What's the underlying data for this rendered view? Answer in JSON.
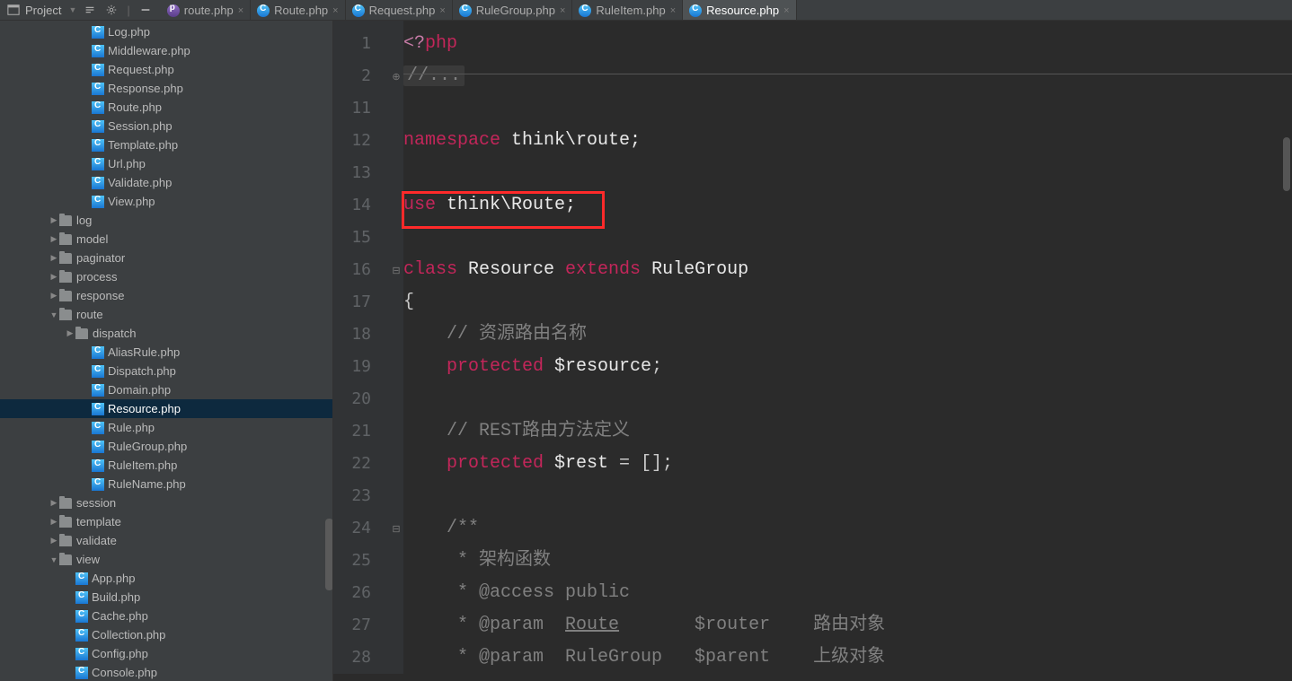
{
  "header": {
    "project_label": "Project"
  },
  "tabs": [
    {
      "label": "route.php",
      "icon": "p",
      "active": false
    },
    {
      "label": "Route.php",
      "icon": "c",
      "active": false
    },
    {
      "label": "Request.php",
      "icon": "c",
      "active": false
    },
    {
      "label": "RuleGroup.php",
      "icon": "c",
      "active": false
    },
    {
      "label": "RuleItem.php",
      "icon": "c",
      "active": false
    },
    {
      "label": "Resource.php",
      "icon": "c",
      "active": true
    }
  ],
  "tree": [
    {
      "indent": 5,
      "type": "file",
      "icon": "c",
      "label": "Log.php"
    },
    {
      "indent": 5,
      "type": "file",
      "icon": "c",
      "label": "Middleware.php"
    },
    {
      "indent": 5,
      "type": "file",
      "icon": "c",
      "label": "Request.php"
    },
    {
      "indent": 5,
      "type": "file",
      "icon": "c",
      "label": "Response.php"
    },
    {
      "indent": 5,
      "type": "file",
      "icon": "c",
      "label": "Route.php"
    },
    {
      "indent": 5,
      "type": "file",
      "icon": "c",
      "label": "Session.php"
    },
    {
      "indent": 5,
      "type": "file",
      "icon": "c",
      "label": "Template.php"
    },
    {
      "indent": 5,
      "type": "file",
      "icon": "c",
      "label": "Url.php"
    },
    {
      "indent": 5,
      "type": "file",
      "icon": "c",
      "label": "Validate.php"
    },
    {
      "indent": 5,
      "type": "file",
      "icon": "c",
      "label": "View.php"
    },
    {
      "indent": 3,
      "type": "folder",
      "arrow": "▶",
      "label": "log"
    },
    {
      "indent": 3,
      "type": "folder",
      "arrow": "▶",
      "label": "model"
    },
    {
      "indent": 3,
      "type": "folder",
      "arrow": "▶",
      "label": "paginator"
    },
    {
      "indent": 3,
      "type": "folder",
      "arrow": "▶",
      "label": "process"
    },
    {
      "indent": 3,
      "type": "folder",
      "arrow": "▶",
      "label": "response"
    },
    {
      "indent": 3,
      "type": "folder",
      "arrow": "▼",
      "label": "route"
    },
    {
      "indent": 4,
      "type": "folder",
      "arrow": "▶",
      "label": "dispatch"
    },
    {
      "indent": 5,
      "type": "file",
      "icon": "c",
      "label": "AliasRule.php"
    },
    {
      "indent": 5,
      "type": "file",
      "icon": "c",
      "label": "Dispatch.php"
    },
    {
      "indent": 5,
      "type": "file",
      "icon": "c",
      "label": "Domain.php"
    },
    {
      "indent": 5,
      "type": "file",
      "icon": "c",
      "label": "Resource.php",
      "selected": true
    },
    {
      "indent": 5,
      "type": "file",
      "icon": "c",
      "label": "Rule.php"
    },
    {
      "indent": 5,
      "type": "file",
      "icon": "c",
      "label": "RuleGroup.php"
    },
    {
      "indent": 5,
      "type": "file",
      "icon": "c",
      "label": "RuleItem.php"
    },
    {
      "indent": 5,
      "type": "file",
      "icon": "c",
      "label": "RuleName.php"
    },
    {
      "indent": 3,
      "type": "folder",
      "arrow": "▶",
      "label": "session"
    },
    {
      "indent": 3,
      "type": "folder",
      "arrow": "▶",
      "label": "template"
    },
    {
      "indent": 3,
      "type": "folder",
      "arrow": "▶",
      "label": "validate"
    },
    {
      "indent": 3,
      "type": "folder",
      "arrow": "▼",
      "label": "view"
    },
    {
      "indent": 4,
      "type": "file",
      "icon": "c",
      "label": "App.php"
    },
    {
      "indent": 4,
      "type": "file",
      "icon": "c",
      "label": "Build.php"
    },
    {
      "indent": 4,
      "type": "file",
      "icon": "c",
      "label": "Cache.php"
    },
    {
      "indent": 4,
      "type": "file",
      "icon": "c",
      "label": "Collection.php"
    },
    {
      "indent": 4,
      "type": "file",
      "icon": "c",
      "label": "Config.php"
    },
    {
      "indent": 4,
      "type": "file",
      "icon": "c",
      "label": "Console.php"
    }
  ],
  "gutter": [
    "1",
    "2",
    "11",
    "12",
    "13",
    "14",
    "15",
    "16",
    "17",
    "18",
    "19",
    "20",
    "21",
    "22",
    "23",
    "24",
    "25",
    "26",
    "27",
    "28"
  ],
  "code": {
    "l1_open": "<?",
    "l1_php": "php",
    "l2": "//...",
    "l4_ns": "namespace",
    "l4_t": " think\\route;",
    "l6_use": "use",
    "l6_t": " think\\Route;",
    "l8_class": "class",
    "l8_name": " Resource ",
    "l8_ext": "extends",
    "l8_rg": " RuleGroup",
    "l9": "{",
    "l10": "    // 资源路由名称",
    "l11_prot": "    protected ",
    "l11_var": "$resource",
    "l11_semi": ";",
    "l13": "    // REST路由方法定义",
    "l14_prot": "    protected ",
    "l14_var": "$rest",
    "l14_eq": " = [];",
    "l16": "    /**",
    "l17": "     * 架构函数",
    "l18": "     * @access public",
    "l19a": "     * @param  ",
    "l19b": "Route",
    "l19c": "       $router    路由对象",
    "l20": "     * @param  RuleGroup   $parent    上级对象"
  }
}
